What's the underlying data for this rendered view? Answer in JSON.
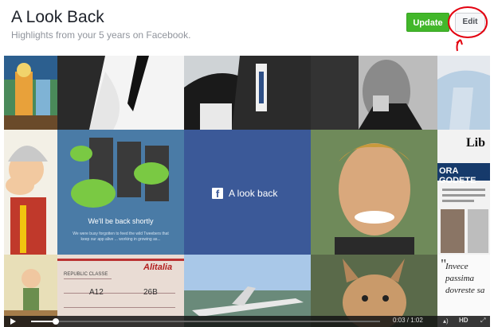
{
  "header": {
    "title": "A Look Back",
    "subtitle": "Highlights from your 5 years on Facebook.",
    "update_label": "Update",
    "edit_label": "Edit"
  },
  "video": {
    "fb_center_label": "A look back",
    "back_shortly_text": "We'll be back shortly",
    "back_shortly_body": "We were busy forgotten to feed the wild Tweebers that keep our app alive ... working in growing as...",
    "newspaper_headline": "ORA GODETE",
    "newspaper_masthead": "Lib",
    "airline_text": "Alitalia",
    "ticket_class": "REPUBLIC CLASSE",
    "ticket_seat": "A12",
    "ticket_number": "26B",
    "quote_text": "Invece passima dovreste sa",
    "quote_mark": "\"",
    "current_time": "0:03",
    "duration": "1:02",
    "time_display": "0:03 / 1:02",
    "progress_fraction": 0.07,
    "hd_label": "HD",
    "volume_icon": "volume-icon",
    "fullscreen_icon": "fullscreen-icon"
  },
  "colors": {
    "update_green": "#42b72a",
    "facebook_blue": "#3b5998",
    "annotation_red": "#e3000f"
  }
}
